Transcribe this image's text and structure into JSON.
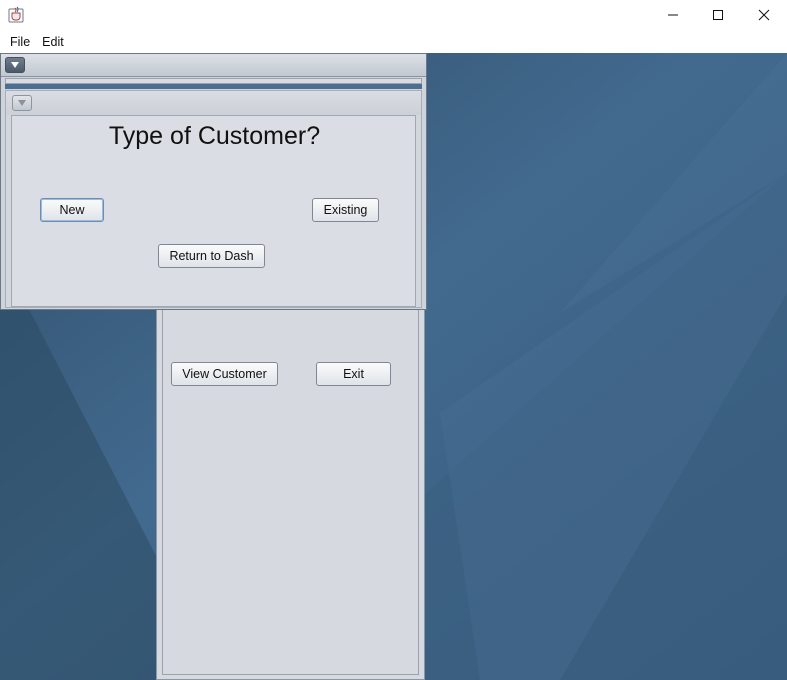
{
  "window": {
    "controls": {
      "minimize": "—",
      "maximize": "☐",
      "close": "✕"
    }
  },
  "menubar": {
    "items": [
      {
        "label": "File"
      },
      {
        "label": "Edit"
      }
    ]
  },
  "customer_dialog": {
    "heading": "Type of Customer?",
    "new_label": "New",
    "existing_label": "Existing",
    "return_label": "Return to Dash"
  },
  "back_frame": {
    "view_customer_label": "View Customer",
    "exit_label": "Exit"
  },
  "colors": {
    "desktop": "#3f6384",
    "panel": "#d6d9df"
  }
}
